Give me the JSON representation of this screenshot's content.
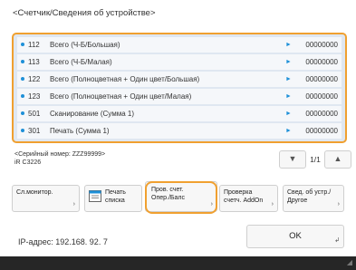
{
  "header": {
    "title": "<Счетчик/Сведения об устройстве>"
  },
  "counters": [
    {
      "code": "112",
      "name": "Всего (Ч-Б/Большая)",
      "value": "00000000"
    },
    {
      "code": "113",
      "name": "Всего (Ч-Б/Малая)",
      "value": "00000000"
    },
    {
      "code": "122",
      "name": "Всего (Полноцветная + Один цвет/Большая)",
      "value": "00000000"
    },
    {
      "code": "123",
      "name": "Всего (Полноцветная + Один цвет/Малая)",
      "value": "00000000"
    },
    {
      "code": "501",
      "name": "Сканирование (Сумма 1)",
      "value": "00000000"
    },
    {
      "code": "301",
      "name": "Печать (Сумма 1)",
      "value": "00000000"
    }
  ],
  "device": {
    "serial_label": "<Серийный номер: ZZZ99999>",
    "model": "iR C3226"
  },
  "pager": {
    "indicator": "1/1",
    "down_icon": "triangle-down-icon",
    "up_icon": "triangle-up-icon"
  },
  "buttons": {
    "monitor": "Сл.монитор.",
    "print_line1": "Печать",
    "print_line2": "списка",
    "check_line1": "Пров. счет.",
    "check_line2": "Опер./Балс",
    "addon_line1": "Проверка",
    "addon_line2": "счетч. AddOn",
    "devinfo_line1": "Свед. об устр./",
    "devinfo_line2": "Другое",
    "ok": "OK",
    "corner_glyph": "›",
    "ok_glyph": "↲"
  },
  "footer": {
    "ip": "IP-адрес: 192.168. 92. 7"
  },
  "colors": {
    "accent": "#f0a030",
    "bullet": "#1e90d8",
    "list_bg": "#dfe7f1"
  }
}
